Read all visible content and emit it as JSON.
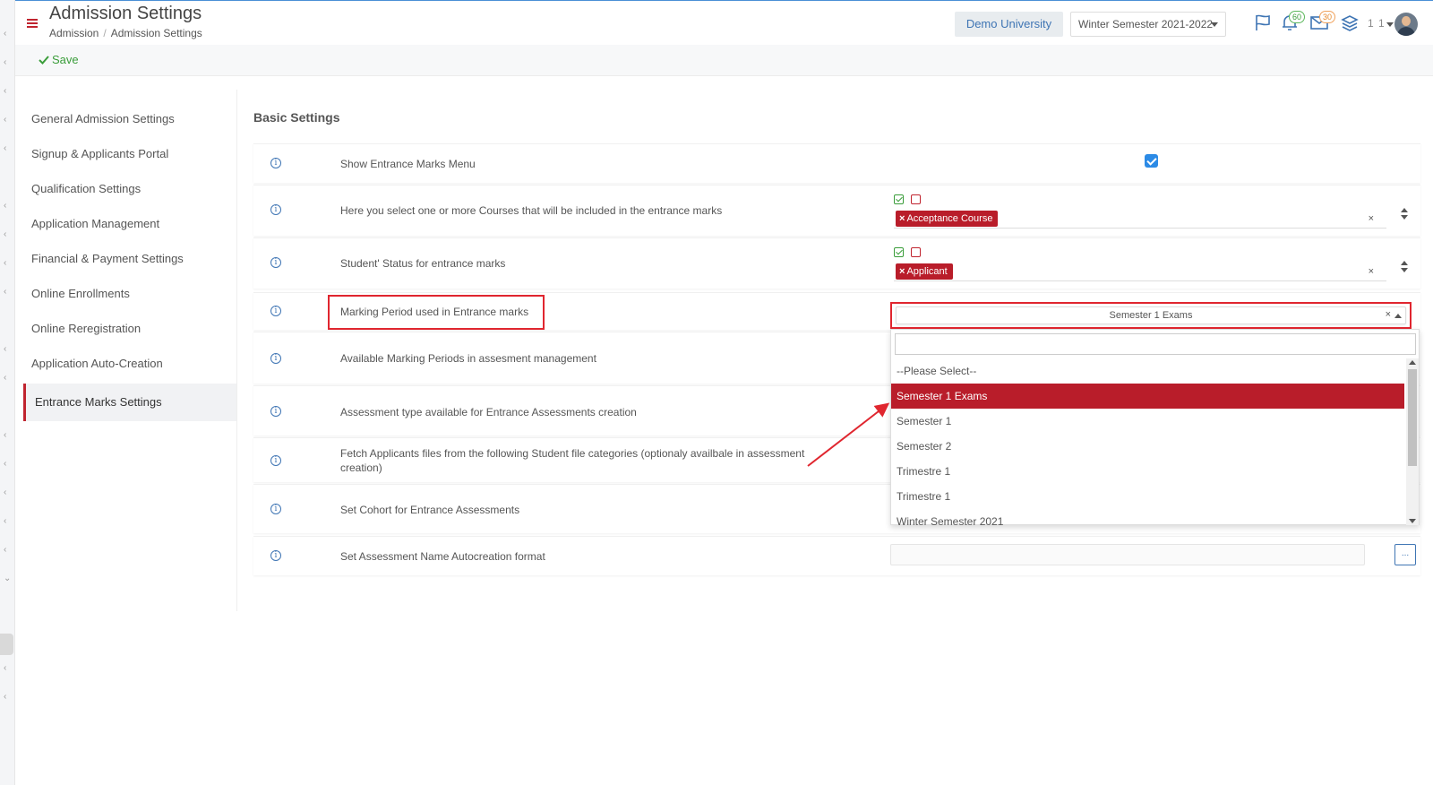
{
  "header": {
    "title": "Admission Settings",
    "breadcrumb": [
      "Admission",
      "Admission Settings"
    ],
    "university": "Demo University",
    "semester": "Winter Semester 2021-2022",
    "flag_badge": "",
    "notifications_count": "60",
    "messages_count": "30",
    "user_code": "1 1"
  },
  "toolbar": {
    "save_label": "Save"
  },
  "sidebar": {
    "items": [
      {
        "label": "General Admission Settings"
      },
      {
        "label": "Signup & Applicants Portal"
      },
      {
        "label": "Qualification Settings"
      },
      {
        "label": "Application Management"
      },
      {
        "label": "Financial & Payment Settings"
      },
      {
        "label": "Online Enrollments"
      },
      {
        "label": "Online Reregistration"
      },
      {
        "label": "Application Auto-Creation"
      },
      {
        "label": "Entrance Marks Settings",
        "active": true
      }
    ]
  },
  "content": {
    "section_title": "Basic Settings",
    "rows": [
      {
        "label": "Show Entrance Marks Menu",
        "checked": true
      },
      {
        "label": "Here you select one or more Courses that will be included in the entrance marks",
        "tag": "Acceptance Course"
      },
      {
        "label": "Student' Status for entrance marks",
        "tag": "Applicant"
      },
      {
        "label": "Marking Period used in Entrance marks",
        "selected": "Semester 1 Exams"
      },
      {
        "label": "Available Marking Periods in assesment management"
      },
      {
        "label": "Assessment type available for Entrance Assessments creation"
      },
      {
        "label": "Fetch Applicants files from the following Student file categories (optionaly availbale in assessment creation)"
      },
      {
        "label": "Set Cohort for Entrance Assessments"
      },
      {
        "label": "Set Assessment Name Autocreation format",
        "button_label": "..."
      }
    ]
  },
  "dropdown": {
    "options": [
      "--Please Select--",
      "Semester 1 Exams",
      "Semester 1",
      "Semester 2",
      "Trimestre 1",
      "Trimestre 1",
      "Winter Semester 2021"
    ],
    "selected_index": 1
  },
  "colors": {
    "accent": "#b91d2a",
    "link": "#3f75b4",
    "success": "#3a9d3a",
    "annotation": "#e0262f"
  }
}
